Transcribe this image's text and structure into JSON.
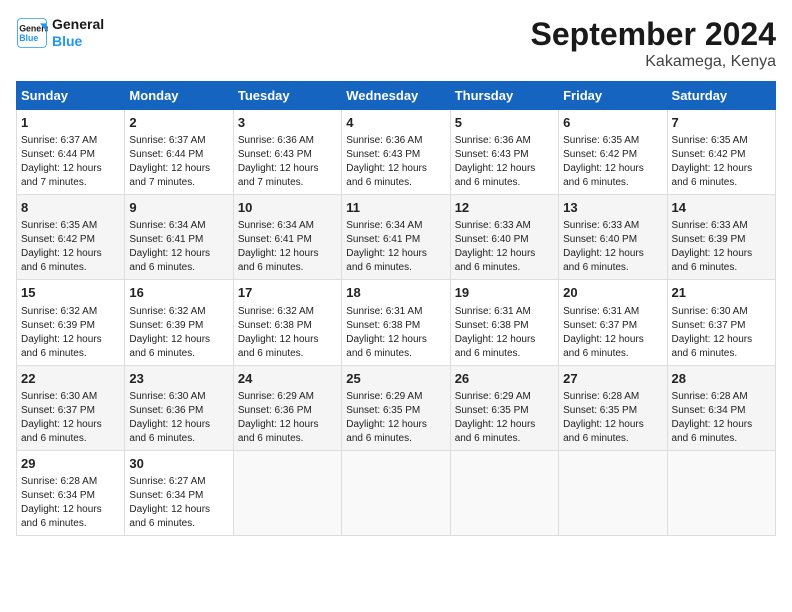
{
  "header": {
    "logo_line1": "General",
    "logo_line2": "Blue",
    "month_title": "September 2024",
    "location": "Kakamega, Kenya"
  },
  "days_of_week": [
    "Sunday",
    "Monday",
    "Tuesday",
    "Wednesday",
    "Thursday",
    "Friday",
    "Saturday"
  ],
  "weeks": [
    [
      {
        "day": "1",
        "sunrise": "6:37 AM",
        "sunset": "6:44 PM",
        "daylight": "12 hours and 7 minutes."
      },
      {
        "day": "2",
        "sunrise": "6:37 AM",
        "sunset": "6:44 PM",
        "daylight": "12 hours and 7 minutes."
      },
      {
        "day": "3",
        "sunrise": "6:36 AM",
        "sunset": "6:43 PM",
        "daylight": "12 hours and 7 minutes."
      },
      {
        "day": "4",
        "sunrise": "6:36 AM",
        "sunset": "6:43 PM",
        "daylight": "12 hours and 6 minutes."
      },
      {
        "day": "5",
        "sunrise": "6:36 AM",
        "sunset": "6:43 PM",
        "daylight": "12 hours and 6 minutes."
      },
      {
        "day": "6",
        "sunrise": "6:35 AM",
        "sunset": "6:42 PM",
        "daylight": "12 hours and 6 minutes."
      },
      {
        "day": "7",
        "sunrise": "6:35 AM",
        "sunset": "6:42 PM",
        "daylight": "12 hours and 6 minutes."
      }
    ],
    [
      {
        "day": "8",
        "sunrise": "6:35 AM",
        "sunset": "6:42 PM",
        "daylight": "12 hours and 6 minutes."
      },
      {
        "day": "9",
        "sunrise": "6:34 AM",
        "sunset": "6:41 PM",
        "daylight": "12 hours and 6 minutes."
      },
      {
        "day": "10",
        "sunrise": "6:34 AM",
        "sunset": "6:41 PM",
        "daylight": "12 hours and 6 minutes."
      },
      {
        "day": "11",
        "sunrise": "6:34 AM",
        "sunset": "6:41 PM",
        "daylight": "12 hours and 6 minutes."
      },
      {
        "day": "12",
        "sunrise": "6:33 AM",
        "sunset": "6:40 PM",
        "daylight": "12 hours and 6 minutes."
      },
      {
        "day": "13",
        "sunrise": "6:33 AM",
        "sunset": "6:40 PM",
        "daylight": "12 hours and 6 minutes."
      },
      {
        "day": "14",
        "sunrise": "6:33 AM",
        "sunset": "6:39 PM",
        "daylight": "12 hours and 6 minutes."
      }
    ],
    [
      {
        "day": "15",
        "sunrise": "6:32 AM",
        "sunset": "6:39 PM",
        "daylight": "12 hours and 6 minutes."
      },
      {
        "day": "16",
        "sunrise": "6:32 AM",
        "sunset": "6:39 PM",
        "daylight": "12 hours and 6 minutes."
      },
      {
        "day": "17",
        "sunrise": "6:32 AM",
        "sunset": "6:38 PM",
        "daylight": "12 hours and 6 minutes."
      },
      {
        "day": "18",
        "sunrise": "6:31 AM",
        "sunset": "6:38 PM",
        "daylight": "12 hours and 6 minutes."
      },
      {
        "day": "19",
        "sunrise": "6:31 AM",
        "sunset": "6:38 PM",
        "daylight": "12 hours and 6 minutes."
      },
      {
        "day": "20",
        "sunrise": "6:31 AM",
        "sunset": "6:37 PM",
        "daylight": "12 hours and 6 minutes."
      },
      {
        "day": "21",
        "sunrise": "6:30 AM",
        "sunset": "6:37 PM",
        "daylight": "12 hours and 6 minutes."
      }
    ],
    [
      {
        "day": "22",
        "sunrise": "6:30 AM",
        "sunset": "6:37 PM",
        "daylight": "12 hours and 6 minutes."
      },
      {
        "day": "23",
        "sunrise": "6:30 AM",
        "sunset": "6:36 PM",
        "daylight": "12 hours and 6 minutes."
      },
      {
        "day": "24",
        "sunrise": "6:29 AM",
        "sunset": "6:36 PM",
        "daylight": "12 hours and 6 minutes."
      },
      {
        "day": "25",
        "sunrise": "6:29 AM",
        "sunset": "6:35 PM",
        "daylight": "12 hours and 6 minutes."
      },
      {
        "day": "26",
        "sunrise": "6:29 AM",
        "sunset": "6:35 PM",
        "daylight": "12 hours and 6 minutes."
      },
      {
        "day": "27",
        "sunrise": "6:28 AM",
        "sunset": "6:35 PM",
        "daylight": "12 hours and 6 minutes."
      },
      {
        "day": "28",
        "sunrise": "6:28 AM",
        "sunset": "6:34 PM",
        "daylight": "12 hours and 6 minutes."
      }
    ],
    [
      {
        "day": "29",
        "sunrise": "6:28 AM",
        "sunset": "6:34 PM",
        "daylight": "12 hours and 6 minutes."
      },
      {
        "day": "30",
        "sunrise": "6:27 AM",
        "sunset": "6:34 PM",
        "daylight": "12 hours and 6 minutes."
      },
      null,
      null,
      null,
      null,
      null
    ]
  ]
}
